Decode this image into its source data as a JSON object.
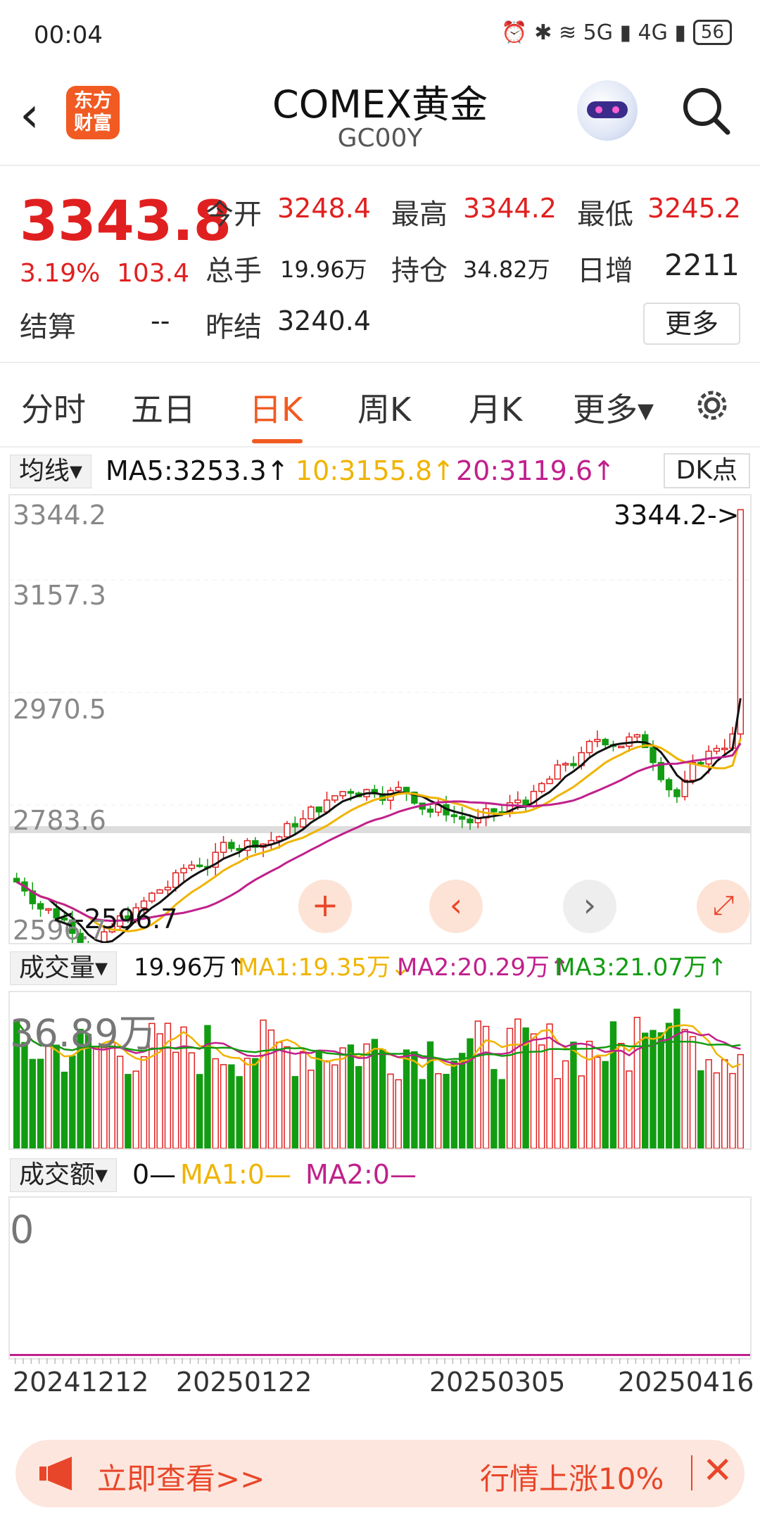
{
  "status": {
    "time": "00:04",
    "icons": "⏰ ✱ ≋ 5G ▮ 4G ▮",
    "battery": "56"
  },
  "header": {
    "title": "COMEX黄金",
    "code": "GC00Y",
    "logo_text": "东方财富"
  },
  "quote": {
    "price": "3343.8",
    "change_pct": "3.19%",
    "change": "103.4",
    "open_label": "今开",
    "open": "3248.4",
    "high_label": "最高",
    "high": "3344.2",
    "low_label": "最低",
    "low": "3245.2",
    "volume_label": "总手",
    "volume": "19.96万",
    "oi_label": "持仓",
    "oi": "34.82万",
    "daily_inc_label": "日增",
    "daily_inc": "2211",
    "settle_label": "结算",
    "settle": "--",
    "prev_settle_label": "昨结",
    "prev_settle": "3240.4",
    "more_label": "更多"
  },
  "tabs": [
    {
      "label": "分时"
    },
    {
      "label": "五日"
    },
    {
      "label": "日K"
    },
    {
      "label": "周K"
    },
    {
      "label": "月K"
    },
    {
      "label": "更多▾"
    }
  ],
  "kline": {
    "selector": "均线▾",
    "ma5": "MA5:3253.3↑",
    "ma10": "10:3155.8↑",
    "ma20": "20:3119.6↑",
    "dk_label": "DK点",
    "y_labels": [
      "3344.2",
      "3157.3",
      "2970.5",
      "2783.6",
      "2596.7"
    ],
    "high_marker": "3344.2->",
    "low_marker": "<-2596.7",
    "colors": {
      "up": "#e02020",
      "down": "#129c12",
      "ma5": "#111111",
      "ma10": "#f0b400",
      "ma20": "#c0208c"
    }
  },
  "volume": {
    "selector": "成交量▾",
    "value": "19.96万↑",
    "ma1": "MA1:19.35万↓",
    "ma2": "MA2:20.29万↑",
    "ma3": "MA3:21.07万↑",
    "max_label": "36.89万"
  },
  "amount": {
    "selector": "成交额▾",
    "value": "0—",
    "ma1": "MA1:0—",
    "ma2": "MA2:0—",
    "zero_label": "0"
  },
  "dates": [
    "20241212",
    "20250122",
    "20250305",
    "20250416"
  ],
  "banner": {
    "left": "立即查看>>",
    "right": "行情上涨10%"
  }
}
